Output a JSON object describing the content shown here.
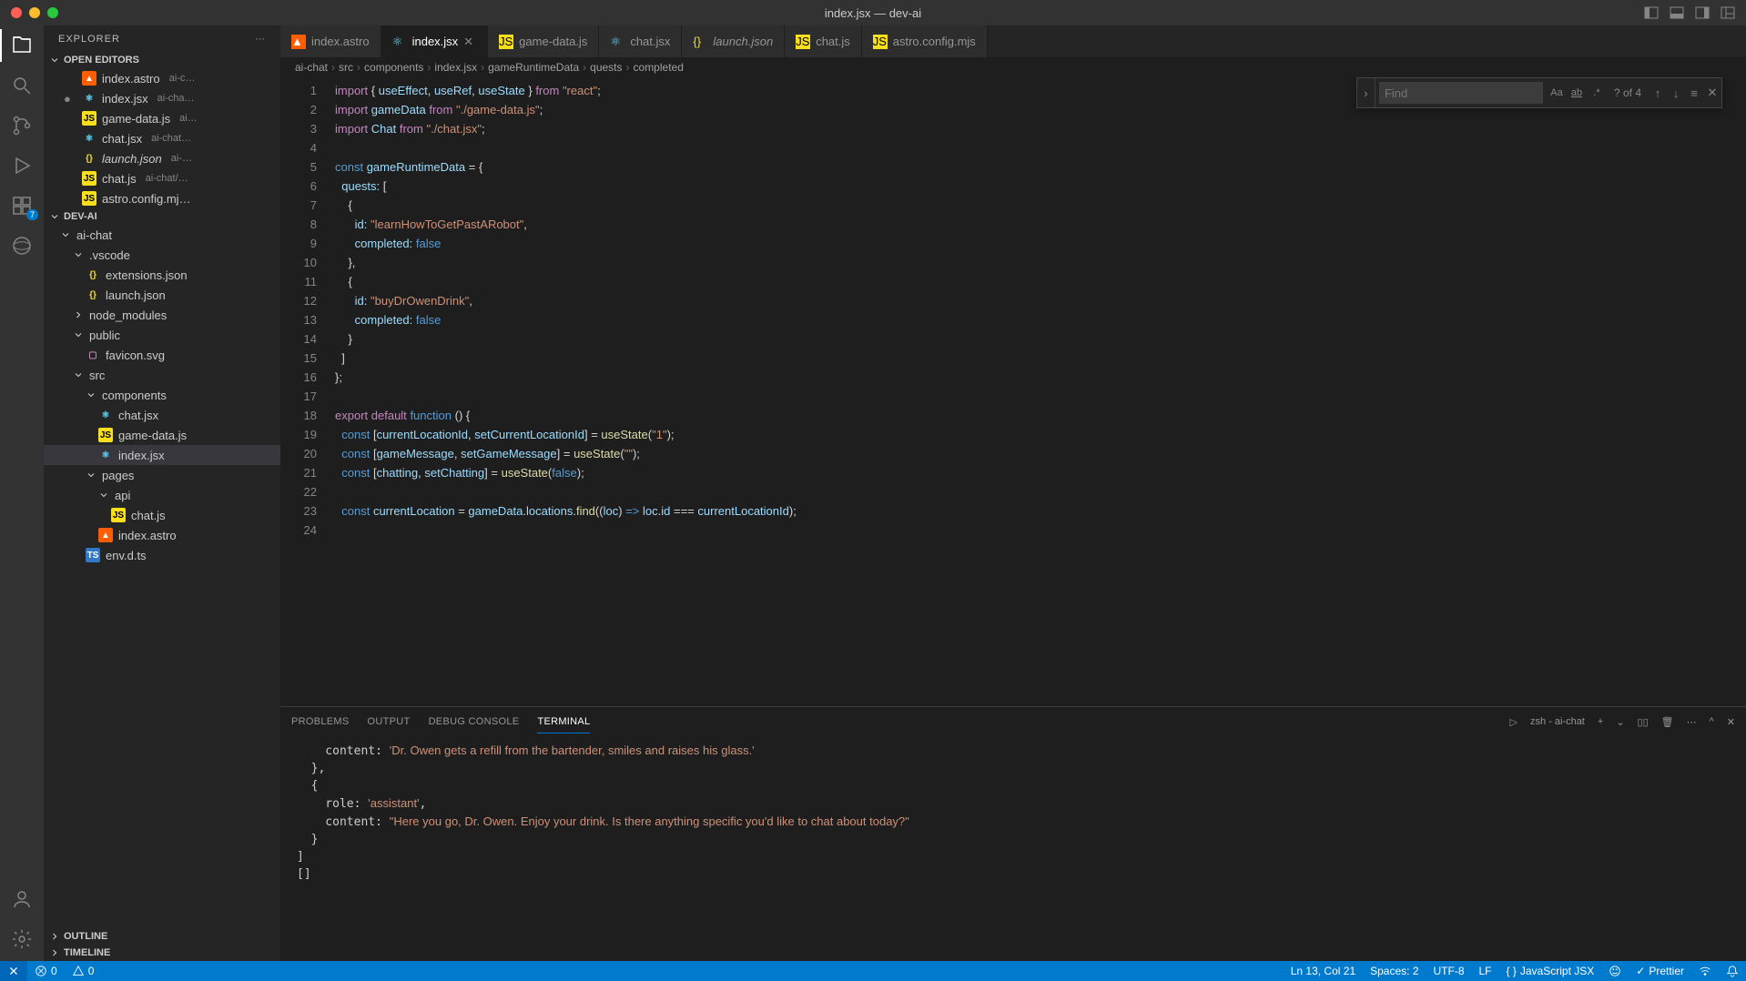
{
  "window": {
    "title": "index.jsx — dev-ai"
  },
  "explorer": {
    "title": "EXPLORER",
    "openEditors": "OPEN EDITORS",
    "project": "DEV-AI",
    "outline": "OUTLINE",
    "timeline": "TIMELINE",
    "editors": [
      {
        "name": "index.astro",
        "detail": "ai-c…",
        "ico": "astro"
      },
      {
        "name": "index.jsx",
        "detail": "ai-cha…",
        "ico": "react",
        "dirty": true
      },
      {
        "name": "game-data.js",
        "detail": "ai…",
        "ico": "js"
      },
      {
        "name": "chat.jsx",
        "detail": "ai-chat…",
        "ico": "react"
      },
      {
        "name": "launch.json",
        "detail": "ai-…",
        "ico": "json",
        "italic": true
      },
      {
        "name": "chat.js",
        "detail": "ai-chat/…",
        "ico": "js"
      },
      {
        "name": "astro.config.mj…",
        "detail": "",
        "ico": "js"
      }
    ],
    "tree": [
      {
        "depth": 0,
        "name": "ai-chat",
        "type": "folder",
        "open": true
      },
      {
        "depth": 1,
        "name": ".vscode",
        "type": "folder",
        "open": true
      },
      {
        "depth": 2,
        "name": "extensions.json",
        "type": "file",
        "ico": "json"
      },
      {
        "depth": 2,
        "name": "launch.json",
        "type": "file",
        "ico": "json"
      },
      {
        "depth": 1,
        "name": "node_modules",
        "type": "folder",
        "open": false
      },
      {
        "depth": 1,
        "name": "public",
        "type": "folder",
        "open": true
      },
      {
        "depth": 2,
        "name": "favicon.svg",
        "type": "file",
        "ico": "svg"
      },
      {
        "depth": 1,
        "name": "src",
        "type": "folder",
        "open": true
      },
      {
        "depth": 2,
        "name": "components",
        "type": "folder",
        "open": true
      },
      {
        "depth": 3,
        "name": "chat.jsx",
        "type": "file",
        "ico": "react"
      },
      {
        "depth": 3,
        "name": "game-data.js",
        "type": "file",
        "ico": "js"
      },
      {
        "depth": 3,
        "name": "index.jsx",
        "type": "file",
        "ico": "react",
        "selected": true
      },
      {
        "depth": 2,
        "name": "pages",
        "type": "folder",
        "open": true
      },
      {
        "depth": 3,
        "name": "api",
        "type": "folder",
        "open": true
      },
      {
        "depth": 4,
        "name": "chat.js",
        "type": "file",
        "ico": "js"
      },
      {
        "depth": 3,
        "name": "index.astro",
        "type": "file",
        "ico": "astro"
      },
      {
        "depth": 2,
        "name": "env.d.ts",
        "type": "file",
        "ico": "ts"
      }
    ]
  },
  "tabs": [
    {
      "name": "index.astro",
      "ico": "astro"
    },
    {
      "name": "index.jsx",
      "ico": "react",
      "active": true,
      "close": true
    },
    {
      "name": "game-data.js",
      "ico": "js"
    },
    {
      "name": "chat.jsx",
      "ico": "react"
    },
    {
      "name": "launch.json",
      "ico": "json",
      "italic": true
    },
    {
      "name": "chat.js",
      "ico": "js"
    },
    {
      "name": "astro.config.mjs",
      "ico": "js"
    }
  ],
  "breadcrumb": [
    "ai-chat",
    "src",
    "components",
    "index.jsx",
    "gameRuntimeData",
    "quests",
    "completed"
  ],
  "find": {
    "placeholder": "Find",
    "result": "? of 4"
  },
  "code": {
    "lines": [
      {
        "n": 1,
        "h": "<span class=k>import</span> <span class=p>{</span> <span class=v>useEffect</span><span class=p>,</span> <span class=v>useRef</span><span class=p>,</span> <span class=v>useState</span> <span class=p>}</span> <span class=k>from</span> <span class=s>\"react\"</span><span class=p>;</span>"
      },
      {
        "n": 2,
        "h": "<span class=k>import</span> <span class=v>gameData</span> <span class=k>from</span> <span class=s>\"./game-data.js\"</span><span class=p>;</span>"
      },
      {
        "n": 3,
        "h": "<span class=k>import</span> <span class=v>Chat</span> <span class=k>from</span> <span class=s>\"./chat.jsx\"</span><span class=p>;</span>"
      },
      {
        "n": 4,
        "h": ""
      },
      {
        "n": 5,
        "h": "<span class=c>const</span> <span class=v>gameRuntimeData</span> <span class=p>=</span> <span class=p>{</span>"
      },
      {
        "n": 6,
        "h": "  <span class=v>quests</span><span class=p>:</span> <span class=p>[</span>"
      },
      {
        "n": 7,
        "h": "    <span class=p>{</span>"
      },
      {
        "n": 8,
        "h": "      <span class=v>id</span><span class=p>:</span> <span class=s>\"learnHowToGetPastARobot\"</span><span class=p>,</span>"
      },
      {
        "n": 9,
        "h": "      <span class=v>completed</span><span class=p>:</span> <span class=b>false</span>"
      },
      {
        "n": 10,
        "h": "    <span class=p>},</span>"
      },
      {
        "n": 11,
        "h": "    <span class=p>{</span>"
      },
      {
        "n": 12,
        "h": "      <span class=v>id</span><span class=p>:</span> <span class=s>\"buyDrOwenDrink\"</span><span class=p>,</span>"
      },
      {
        "n": 13,
        "h": "      <span class=v>completed</span><span class=p>:</span> <span class=b>false</span>"
      },
      {
        "n": 14,
        "h": "    <span class=p>}</span>"
      },
      {
        "n": 15,
        "h": "  <span class=p>]</span>"
      },
      {
        "n": 16,
        "h": "<span class=p>};</span>"
      },
      {
        "n": 17,
        "h": ""
      },
      {
        "n": 18,
        "h": "<span class=k>export</span> <span class=k>default</span> <span class=c>function</span> <span class=p>()</span> <span class=p>{</span>"
      },
      {
        "n": 19,
        "h": "  <span class=c>const</span> <span class=p>[</span><span class=v>currentLocationId</span><span class=p>,</span> <span class=v>setCurrentLocationId</span><span class=p>]</span> <span class=p>=</span> <span class=fn>useState</span><span class=p>(</span><span class=s>\"1\"</span><span class=p>);</span>"
      },
      {
        "n": 20,
        "h": "  <span class=c>const</span> <span class=p>[</span><span class=v>gameMessage</span><span class=p>,</span> <span class=v>setGameMessage</span><span class=p>]</span> <span class=p>=</span> <span class=fn>useState</span><span class=p>(</span><span class=s>\"\"</span><span class=p>);</span>"
      },
      {
        "n": 21,
        "h": "  <span class=c>const</span> <span class=p>[</span><span class=v>chatting</span><span class=p>,</span> <span class=v>setChatting</span><span class=p>]</span> <span class=p>=</span> <span class=fn>useState</span><span class=p>(</span><span class=b>false</span><span class=p>);</span>"
      },
      {
        "n": 22,
        "h": ""
      },
      {
        "n": 23,
        "h": "  <span class=c>const</span> <span class=v>currentLocation</span> <span class=p>=</span> <span class=v>gameData</span><span class=p>.</span><span class=v>locations</span><span class=p>.</span><span class=fn>find</span><span class=p>((</span><span class=v>loc</span><span class=p>)</span> <span class=c>=></span> <span class=v>loc</span><span class=p>.</span><span class=v>id</span> <span class=p>===</span> <span class=v>currentLocationId</span><span class=p>);</span>"
      },
      {
        "n": 24,
        "h": ""
      }
    ]
  },
  "panel": {
    "tabs": [
      "PROBLEMS",
      "OUTPUT",
      "DEBUG CONSOLE",
      "TERMINAL"
    ],
    "activeTab": 3,
    "shell": "zsh - ai-chat",
    "content": "    content: <span class=s>'Dr. Owen gets a refill from the bartender, smiles and raises his glass.'</span>\n  },\n  {\n    role: <span class=s>'assistant'</span>,\n    content: <span class=s>\"Here you go, Dr. Owen. Enjoy your drink. Is there anything specific you'd like to chat about today?\"</span>\n  }\n]\n[]"
  },
  "status": {
    "errors": "0",
    "warnings": "0",
    "cursor": "Ln 13, Col 21",
    "spaces": "Spaces: 2",
    "encoding": "UTF-8",
    "eol": "LF",
    "lang": "JavaScript JSX",
    "prettier": "Prettier"
  },
  "activity": {
    "extBadge": "7"
  }
}
